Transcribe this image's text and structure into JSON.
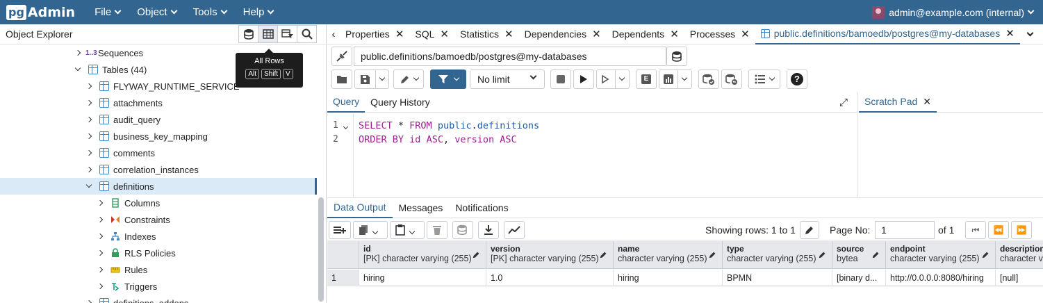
{
  "app": {
    "logo_pg": "pg",
    "logo_admin": "Admin",
    "menu": [
      "File",
      "Object",
      "Tools",
      "Help"
    ],
    "user": "admin@example.com (internal)"
  },
  "left_panel": {
    "title": "Object Explorer",
    "tooltip": {
      "title": "All Rows",
      "keys": [
        "Alt",
        "Shift",
        "V"
      ]
    },
    "tree": [
      {
        "label": "Sequences",
        "prefix": "1..3",
        "expanded": false
      },
      {
        "label": "Tables (44)",
        "expanded": true
      },
      {
        "label": "FLYWAY_RUNTIME_SERVICE",
        "expanded": false
      },
      {
        "label": "attachments",
        "expanded": false
      },
      {
        "label": "audit_query",
        "expanded": false
      },
      {
        "label": "business_key_mapping",
        "expanded": false
      },
      {
        "label": "comments",
        "expanded": false
      },
      {
        "label": "correlation_instances",
        "expanded": false
      },
      {
        "label": "definitions",
        "expanded": true,
        "selected": true
      },
      {
        "label": "Columns",
        "expanded": false
      },
      {
        "label": "Constraints",
        "expanded": false
      },
      {
        "label": "Indexes",
        "expanded": false
      },
      {
        "label": "RLS Policies",
        "expanded": false
      },
      {
        "label": "Rules",
        "expanded": false
      },
      {
        "label": "Triggers",
        "expanded": false
      },
      {
        "label": "definitions_addons",
        "expanded": false
      }
    ]
  },
  "tabs": [
    "Properties",
    "SQL",
    "Statistics",
    "Dependencies",
    "Dependents",
    "Processes"
  ],
  "active_tab": "public.definitions/bamoedb/postgres@my-databases",
  "connection": "public.definitions/bamoedb/postgres@my-databases",
  "toolbar": {
    "limit": "No limit"
  },
  "query": {
    "tabs": [
      "Query",
      "Query History"
    ],
    "lines": [
      "1",
      "2"
    ]
  },
  "scratch": {
    "title": "Scratch Pad"
  },
  "output": {
    "tabs": [
      "Data Output",
      "Messages",
      "Notifications"
    ],
    "rows_info": "Showing rows: 1 to 1",
    "page_label": "Page No:",
    "page_value": "1",
    "page_of": "of 1"
  },
  "grid": {
    "columns": [
      {
        "name": "id",
        "type": "[PK] character varying (255)"
      },
      {
        "name": "version",
        "type": "[PK] character varying (255)"
      },
      {
        "name": "name",
        "type": "character varying (255)"
      },
      {
        "name": "type",
        "type": "character varying (255)"
      },
      {
        "name": "source",
        "type": "bytea"
      },
      {
        "name": "endpoint",
        "type": "character varying (255)"
      },
      {
        "name": "description",
        "type": "character varying"
      }
    ],
    "rows": [
      {
        "num": "1",
        "cells": [
          "hiring",
          "1.0",
          "hiring",
          "BPMN",
          "[binary d...",
          "http://0.0.0.0:8080/hiring",
          "[null]"
        ]
      }
    ]
  },
  "colors": {
    "brand": "#326690",
    "selected": "#dbeaf7",
    "keyword": "#9d1e8e",
    "identifier": "#1f5aa8"
  }
}
